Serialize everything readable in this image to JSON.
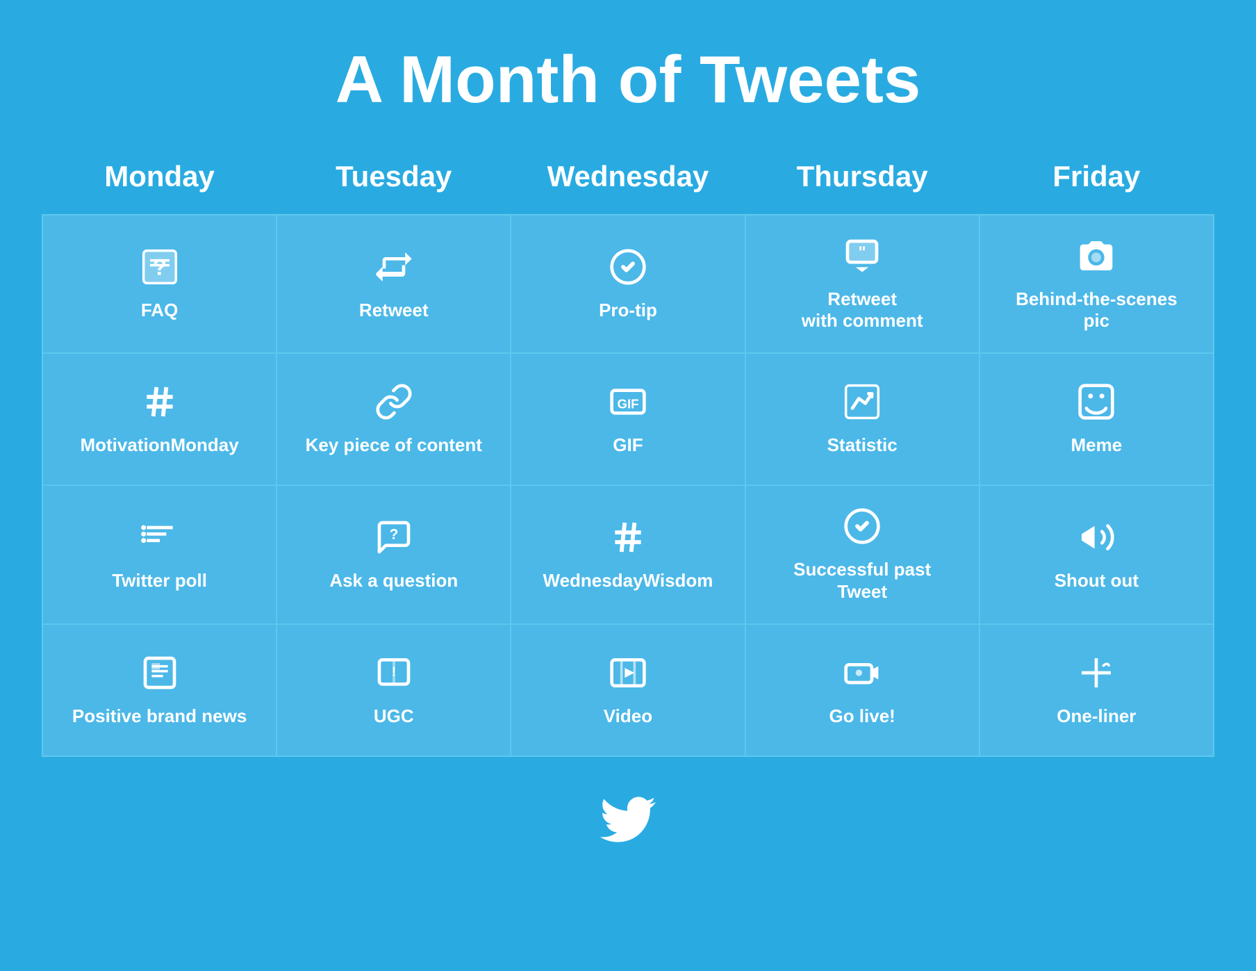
{
  "title": "A Month of Tweets",
  "columns": [
    "Monday",
    "Tuesday",
    "Wednesday",
    "Thursday",
    "Friday"
  ],
  "rows": [
    [
      {
        "icon": "faq",
        "label": "FAQ"
      },
      {
        "icon": "retweet",
        "label": "Retweet"
      },
      {
        "icon": "protip",
        "label": "Pro-tip"
      },
      {
        "icon": "retweet-comment",
        "label": "Retweet\nwith comment"
      },
      {
        "icon": "camera",
        "label": "Behind-the-scenes\npic"
      }
    ],
    [
      {
        "icon": "hashtag",
        "label": "MotivationMonday"
      },
      {
        "icon": "link",
        "label": "Key piece of content"
      },
      {
        "icon": "gif",
        "label": "GIF"
      },
      {
        "icon": "statistic",
        "label": "Statistic"
      },
      {
        "icon": "meme",
        "label": "Meme"
      }
    ],
    [
      {
        "icon": "poll",
        "label": "Twitter poll"
      },
      {
        "icon": "question",
        "label": "Ask a question"
      },
      {
        "icon": "hashtag2",
        "label": "WednesdayWisdom"
      },
      {
        "icon": "check",
        "label": "Successful past\nTweet"
      },
      {
        "icon": "shoutout",
        "label": "Shout out"
      }
    ],
    [
      {
        "icon": "news",
        "label": "Positive brand news"
      },
      {
        "icon": "ugc",
        "label": "UGC"
      },
      {
        "icon": "video",
        "label": "Video"
      },
      {
        "icon": "live",
        "label": "Go live!"
      },
      {
        "icon": "oneliner",
        "label": "One-liner"
      }
    ]
  ],
  "footer_icon": "twitter"
}
